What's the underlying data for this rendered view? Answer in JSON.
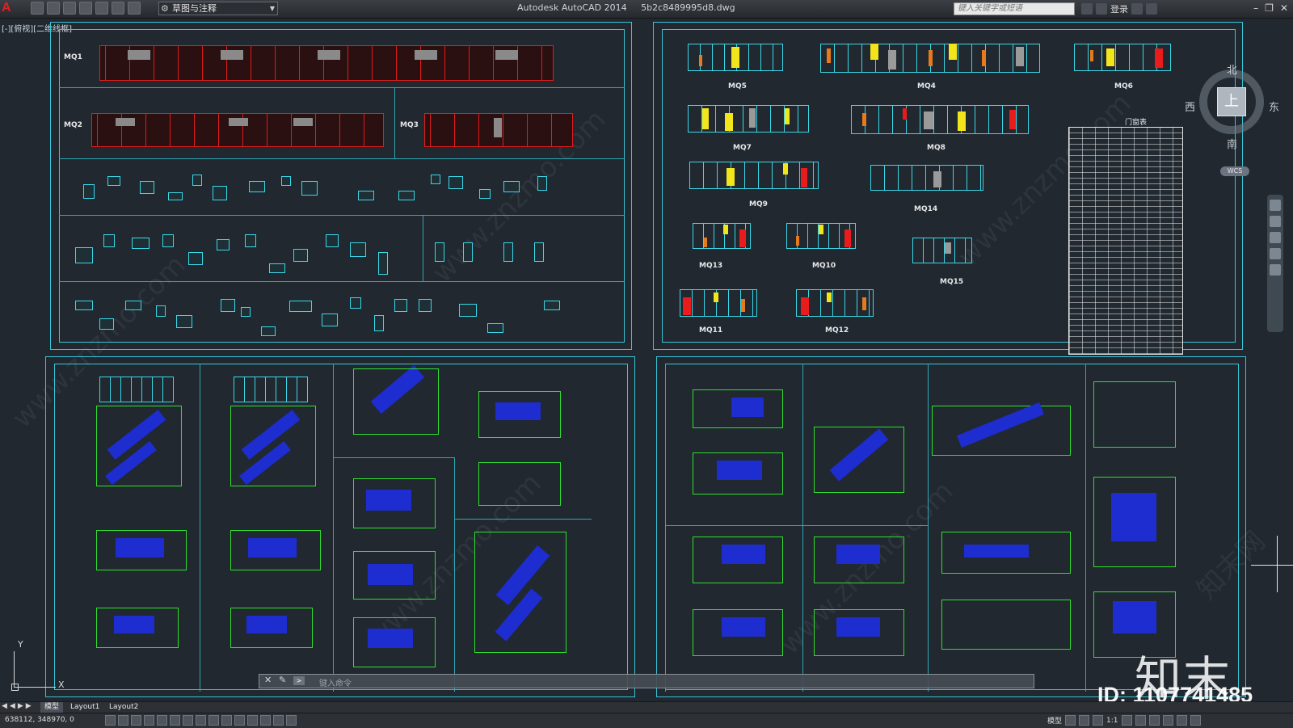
{
  "titlebar": {
    "app_name": "Autodesk AutoCAD 2014",
    "file_name": "5b2c8489995d8.dwg",
    "workspace": "草图与注释",
    "search_placeholder": "键入关键字或短语",
    "login_label": "登录"
  },
  "viewport": {
    "label": "[-][俯视][二维线框]"
  },
  "drawing": {
    "sheet_top_left_tags": [
      "MQ1",
      "MQ2",
      "MQ3"
    ],
    "sheet_top_right_tags": [
      "MQ5",
      "MQ4",
      "MQ6",
      "MQ7",
      "MQ8",
      "MQ9",
      "MQ14",
      "MQ13",
      "MQ10",
      "MQ15",
      "MQ11",
      "MQ12"
    ],
    "schedule_title": "门窗表"
  },
  "viewcube": {
    "north": "北",
    "south": "南",
    "east": "东",
    "west": "西",
    "face": "上",
    "wcs": "WCS"
  },
  "ucs": {
    "x_label": "X",
    "y_label": "Y"
  },
  "command_line": {
    "placeholder": "键入命令"
  },
  "layout_tabs": [
    "模型",
    "Layout1",
    "Layout2"
  ],
  "status": {
    "coordinates": "638112, 348970, 0",
    "scale": "1:1",
    "model_label": "模型"
  },
  "watermark": {
    "brand": "知末",
    "id": "ID: 1107741485",
    "site": "www.znzmo.com",
    "site_cn": "知末网"
  },
  "colors": {
    "background": "#212830",
    "sheet_border": "#37c6d8",
    "red_elevation": "#e21c1c",
    "stair_blue": "#1d2dcf",
    "dimension_green": "#2fe02f"
  }
}
